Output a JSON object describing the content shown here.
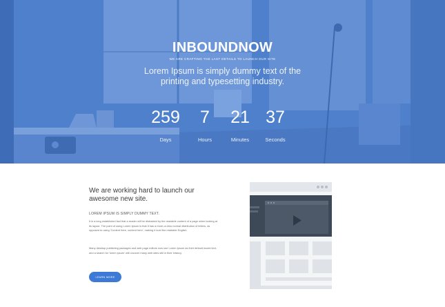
{
  "hero": {
    "brand": "INBOUNDNOW",
    "tagline": "WE ARE CRAFTING THE LAST DETAILS TO LAUNCH OUR SITE",
    "headline": "Lorem Ipsum is simply dummy text of the printing and typesetting industry.",
    "overlay_color": "#3f74c8"
  },
  "countdown": [
    {
      "value": "259",
      "label": "Days"
    },
    {
      "value": "7",
      "label": "Hours"
    },
    {
      "value": "21",
      "label": "Minutes"
    },
    {
      "value": "37",
      "label": "Seconds"
    }
  ],
  "content": {
    "heading": "We are working hard to launch our awesome new site.",
    "subheading": "LOREM IPSUM IS SIMPLY DUMMY TEXT.",
    "paragraph1": "It is a long established fact that a reader will be distracted by the readable content of a page when looking at its layout. The point of using Lorem Ipsum is that it has a more-or-less normal distribution of letters, as opposed to using 'Content here, content here', making it look like readable English.",
    "paragraph2": "Many desktop publishing packages and web page editors now use Lorem Ipsum as their default model text, and a search for 'lorem ipsum' will uncover many web sites still in their infancy.",
    "button_label": "LEARN MORE",
    "accent_color": "#3d7ad6"
  },
  "mockup": {
    "icon": "browser-video-mockup-icon",
    "play_icon": "play-icon"
  }
}
